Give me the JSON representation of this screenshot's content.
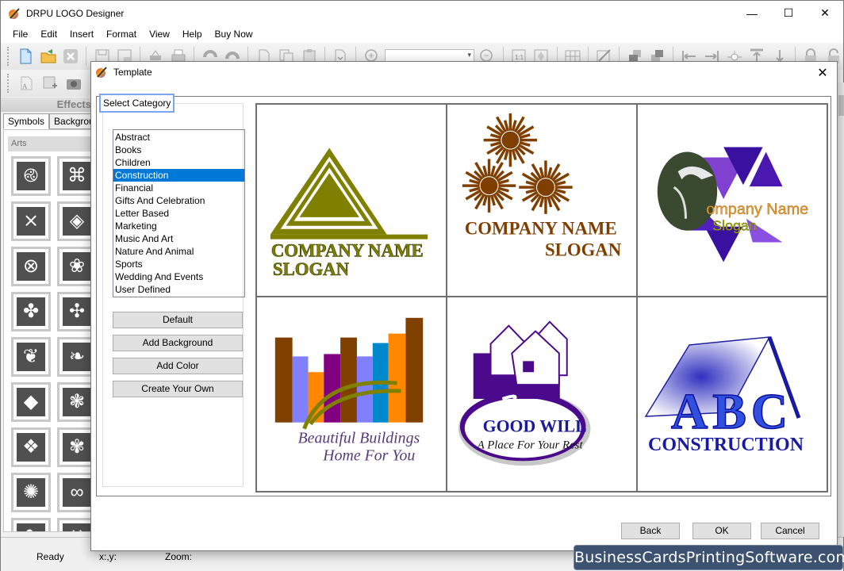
{
  "window": {
    "title": "DRPU LOGO Designer",
    "controls": {
      "minimize": "—",
      "maximize": "☐",
      "close": "✕"
    }
  },
  "menu": [
    "File",
    "Edit",
    "Insert",
    "Format",
    "View",
    "Help",
    "Buy Now"
  ],
  "toolbar": {
    "icons": [
      "new-file-icon",
      "open-folder-icon",
      "close-file-icon",
      "save-icon",
      "save-as-icon",
      "print-setup-icon",
      "print-icon",
      "undo-icon",
      "redo-icon",
      "cut-icon",
      "copy-icon",
      "paste-icon",
      "delete-icon",
      "zoom-in-icon",
      "zoom-out-icon",
      "actual-size-icon",
      "fit-page-icon",
      "grid-icon",
      "line-tool-icon",
      "bring-front-icon",
      "send-back-icon",
      "align-left-icon",
      "align-right-icon",
      "align-center-icon",
      "align-top-icon",
      "align-bottom-icon",
      "lock-icon",
      "unlock-icon"
    ],
    "zoom_value": ""
  },
  "left_panel": {
    "header": "Effects",
    "tabs": [
      "Symbols",
      "Backgroun"
    ],
    "section": "Arts",
    "symbols": [
      "triskelion",
      "celtic-knot-square",
      "cross-weave",
      "diamond-knot",
      "circle-knot",
      "quatrefoil-knot",
      "cross-flower",
      "swirl-dots",
      "lotus-circle",
      "scroll-frame",
      "diamond-leaf",
      "fan-shell",
      "diamond-fan",
      "fleur-ornament",
      "mandala",
      "curl-ornament",
      "heart-knot",
      "swoosh"
    ]
  },
  "status": {
    "ready": "Ready",
    "coords": "x:,y:",
    "zoom": "Zoom:"
  },
  "dialog": {
    "title": "Template",
    "close": "✕",
    "category_label": "Select Category",
    "categories": [
      "Abstract",
      "Books",
      "Children",
      "Construction",
      "Financial",
      "Gifts And Celebration",
      "Letter Based",
      "Marketing",
      "Music And Art",
      "Nature And Animal",
      "Sports",
      "Wedding And Events",
      "User Defined"
    ],
    "selected_category": "Construction",
    "side_buttons": [
      "Default",
      "Add Background",
      "Add Color",
      "Create Your Own"
    ],
    "templates": [
      {
        "name": "triangle",
        "line1": "COMPANY NAME",
        "line2": "SLOGAN",
        "color": "#808000"
      },
      {
        "name": "sunbursts",
        "line1": "COMPANY NAME",
        "line2": "SLOGAN",
        "color": "#7f3f00"
      },
      {
        "name": "helmet-triangles",
        "line1": "ompany Name",
        "line2": "Slogan",
        "color": "#f0a030",
        "color2": "#a0b000"
      },
      {
        "name": "buildings",
        "line1": "Beautiful Buildings",
        "line2": "Home For You",
        "color": "#5a3a7a"
      },
      {
        "name": "good-will",
        "line1": "GOOD WILL",
        "line2": "A Place For Your Rest",
        "color": "#2a2a9a"
      },
      {
        "name": "abc-construction",
        "line1": "ABC",
        "line2": "CONSTRUCTION",
        "color": "#1a1aa0"
      }
    ],
    "buttons": {
      "back": "Back",
      "ok": "OK",
      "cancel": "Cancel"
    }
  },
  "watermark": "BusinessCardsPrintingSoftware.com"
}
